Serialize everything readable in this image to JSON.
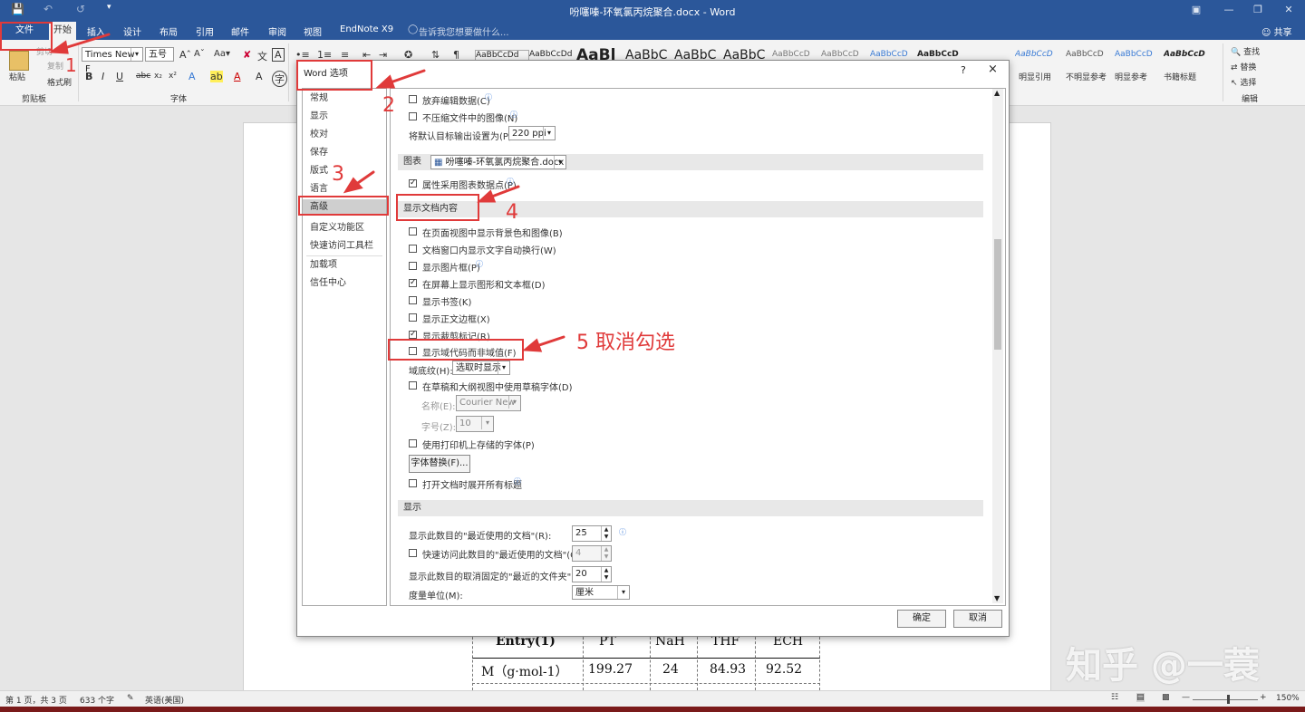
{
  "titlebar": {
    "title": "吩噻嗪-环氧氯丙烷聚合.docx - Word",
    "share": "共享"
  },
  "tabs": [
    "文件",
    "开始",
    "插入",
    "设计",
    "布局",
    "引用",
    "邮件",
    "审阅",
    "视图",
    "EndNote X9"
  ],
  "tell_me": "告诉我您想要做什么...",
  "ribbon": {
    "paste": "粘贴",
    "cut": "剪切",
    "copy": "复制",
    "format_painter": "格式刷",
    "clipboard_group": "剪贴板",
    "font_name": "Times New F",
    "font_size": "五号",
    "font_group": "字体",
    "styles": [
      "AaBbCcDd",
      "AaBbCcDd",
      "AaBl",
      "AaBbC",
      "AaBbC",
      "AaBbC",
      "AaBbCcD",
      "AaBbCcD",
      "AaBbCcD",
      "AaBbCcD",
      "AaBbCcD",
      "AaBbCcD",
      "AaBbCcD",
      "AaBbCcD"
    ],
    "style_labels": [
      "明显引用",
      "不明显参考",
      "明显参考",
      "书籍标题"
    ],
    "find": "查找",
    "replace": "替换",
    "select": "选择",
    "edit_group": "编辑"
  },
  "dialog": {
    "title": "Word 选项",
    "help": "?",
    "close": "×",
    "nav": [
      "常规",
      "显示",
      "校对",
      "保存",
      "版式",
      "语言",
      "高级",
      "自定义功能区",
      "快速访问工具栏",
      "加载项",
      "信任中心"
    ],
    "rows": {
      "discard_edit": "放弃编辑数据(C)",
      "no_compress": "不压缩文件中的图像(N)",
      "default_output": "将默认目标输出设置为(P):",
      "ppi": "220 ppi",
      "chart_label": "图表",
      "chart_doc": "吩噻嗪-环氧氯丙烷聚合.docx",
      "chart_props": "属性采用图表数据点(P)",
      "sec_show_content": "显示文档内容",
      "bg_colors": "在页面视图中显示背景色和图像(B)",
      "wrap": "文档窗口内显示文字自动换行(W)",
      "pic_placeholder": "显示图片框(P)",
      "drawings": "在屏幕上显示图形和文本框(D)",
      "bookmarks": "显示书签(K)",
      "text_bounds": "显示正文边框(X)",
      "crop_marks": "显示裁剪标记(R)",
      "field_codes": "显示域代码而非域值(F)",
      "field_shading": "域底纹(H):",
      "field_shading_val": "选取时显示",
      "draft_font": "在草稿和大纲视图中使用草稿字体(D)",
      "name_label": "名称(E):",
      "name_val": "Courier New",
      "size_label": "字号(Z):",
      "size_val": "10",
      "printer_fonts": "使用打印机上存储的字体(P)",
      "font_sub": "字体替换(F)...",
      "expand_headings": "打开文档时展开所有标题",
      "sec_display": "显示",
      "recent_docs": "显示此数目的\"最近使用的文档\"(R):",
      "recent_docs_val": "25",
      "quick_recent": "快速访问此数目的\"最近使用的文档\"(Q):",
      "quick_recent_val": "4",
      "recent_folders": "显示此数目的取消固定的\"最近的文件夹\"(F):",
      "recent_folders_val": "20",
      "units": "度量单位(M):",
      "units_val": "厘米"
    },
    "ok": "确定",
    "cancel": "取消"
  },
  "annotations": {
    "n1": "1",
    "n2": "2",
    "n3": "3",
    "n4": "4",
    "n5": "5 取消勾选"
  },
  "doc_table": {
    "headers": [
      "Entry(1)",
      "PT",
      "NaH",
      "THF",
      "ECH"
    ],
    "row1": [
      "M（g·mol-1）",
      "199.27",
      "24",
      "84.93",
      "92.52"
    ]
  },
  "status": {
    "page": "第 1 页，共 3 页",
    "words": "633 个字",
    "lang": "英语(美国)",
    "zoom": "150%"
  },
  "watermark": "知乎 @一蓑",
  "colors": {
    "accent": "#2b579a",
    "annotation": "#e03a3a"
  }
}
